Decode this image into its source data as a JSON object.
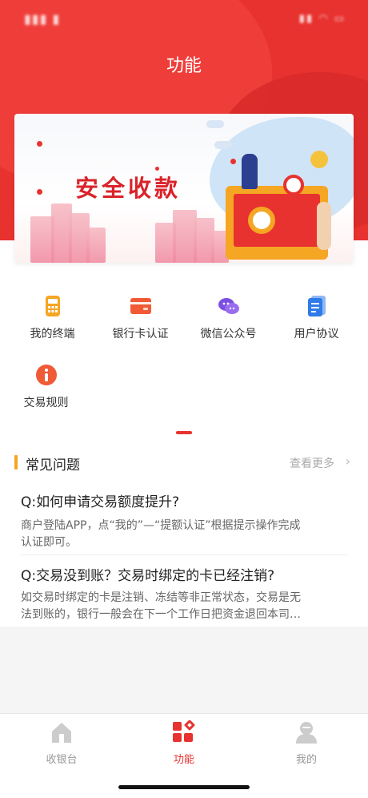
{
  "page": {
    "title": "功能"
  },
  "colors": {
    "accent": "#e8322f",
    "orange": "#f5a623",
    "tab_inactive": "#999999"
  },
  "banner": {
    "title": "安全收款"
  },
  "features": [
    {
      "label": "我的终端",
      "icon": "pos-terminal-icon",
      "color": "#f5a623"
    },
    {
      "label": "银行卡认证",
      "icon": "bank-card-icon",
      "color": "#f05a36"
    },
    {
      "label": "微信公众号",
      "icon": "wechat-icon",
      "color": "#7b4fe0"
    },
    {
      "label": "用户协议",
      "icon": "document-icon",
      "color": "#2f7be8"
    },
    {
      "label": "交易规则",
      "icon": "info-icon",
      "color": "#f05a36"
    }
  ],
  "faq": {
    "title": "常见问题",
    "more": "查看更多",
    "items": [
      {
        "q": "Q:如何申请交易额度提升?",
        "a1": "商户登陆APP，点“我的”—“提额认证”根据提示操作完成",
        "a2": "认证即可。"
      },
      {
        "q": "Q:交易没到账？交易时绑定的卡已经注销?",
        "a1": "如交易时绑定的卡是注销、冻结等非正常状态，交易是无",
        "a2": "法到账的，银行一般会在下一个工作日把资金退回本司…"
      }
    ]
  },
  "tabs": [
    {
      "label": "收银台",
      "icon": "home-icon",
      "active": false
    },
    {
      "label": "功能",
      "icon": "grid-icon",
      "active": true
    },
    {
      "label": "我的",
      "icon": "user-icon",
      "active": false
    }
  ]
}
